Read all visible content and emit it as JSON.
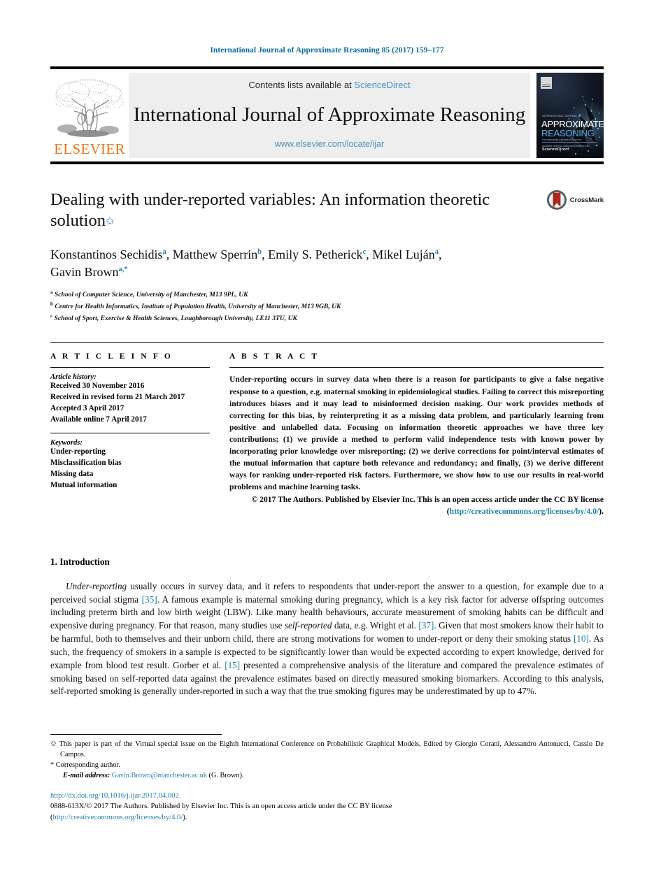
{
  "running_head": "International Journal of Approximate Reasoning 85 (2017) 159–177",
  "masthead": {
    "contents_prefix": "Contents lists available at ",
    "sciencedirect": "ScienceDirect",
    "journal_title": "International Journal of Approximate Reasoning",
    "journal_url": "www.elsevier.com/locate/ijar",
    "publisher_wordmark": "ELSEVIER",
    "cover": {
      "brand_small": "INTERNATIONAL JOURNAL OF",
      "line1": "APPROXIMATE",
      "line2": "REASONING",
      "tagline": "Uncertainty in Intelligent Systems",
      "footer_small": "Available online at www.sciencedirect.com",
      "footer_brand": "ScienceDirect"
    }
  },
  "article": {
    "title": "Dealing with under-reported variables: An information theoretic solution",
    "title_footnote_mark": "✩",
    "crossmark_label": "CrossMark",
    "authors_line1": "Konstantinos Sechidis a, Matthew Sperrin b, Emily S. Petherick c, Mikel Luján a,",
    "authors_line2": "Gavin Brown a,*",
    "authors": [
      {
        "name": "Konstantinos Sechidis",
        "marks": "a"
      },
      {
        "name": "Matthew Sperrin",
        "marks": "b"
      },
      {
        "name": "Emily S. Petherick",
        "marks": "c"
      },
      {
        "name": "Mikel Luján",
        "marks": "a"
      },
      {
        "name": "Gavin Brown",
        "marks": "a,*"
      }
    ],
    "affiliations": [
      {
        "mark": "a",
        "text": "School of Computer Science, University of Manchester, M13 9PL, UK"
      },
      {
        "mark": "b",
        "text": "Centre for Health Informatics, Institute of Population Health, University of Manchester, M13 9GB, UK"
      },
      {
        "mark": "c",
        "text": "School of Sport, Exercise & Health Sciences, Loughborough University, LE11 3TU, UK"
      }
    ]
  },
  "article_info": {
    "heading": "A R T I C L E   I N F O",
    "history_label": "Article history:",
    "history": [
      "Received 30 November 2016",
      "Received in revised form 21 March 2017",
      "Accepted 3 April 2017",
      "Available online 7 April 2017"
    ],
    "keywords_label": "Keywords:",
    "keywords": [
      "Under-reporting",
      "Misclassification bias",
      "Missing data",
      "Mutual information"
    ]
  },
  "abstract": {
    "heading": "A B S T R A C T",
    "body": "Under-reporting occurs in survey data when there is a reason for participants to give a false negative response to a question, e.g. maternal smoking in epidemiological studies. Failing to correct this misreporting introduces biases and it may lead to misinformed decision making. Our work provides methods of correcting for this bias, by reinterpreting it as a missing data problem, and particularly learning from positive and unlabelled data. Focusing on information theoretic approaches we have three key contributions; (1) we provide a method to perform valid independence tests with known power by incorporating prior knowledge over misreporting; (2) we derive corrections for point/interval estimates of the mutual information that capture both relevance and redundancy; and finally, (3) we derive different ways for ranking under-reported risk factors. Furthermore, we show how to use our results in real-world problems and machine learning tasks.",
    "copyright_text": "© 2017 The Authors. Published by Elsevier Inc. This is an open access article under the CC BY license (",
    "copyright_link": "http://creativecommons.org/licenses/by/4.0/",
    "copyright_tail": ")."
  },
  "introduction": {
    "number_title": "1. Introduction",
    "paragraph_parts": [
      {
        "type": "italic",
        "text": "Under-reporting"
      },
      {
        "type": "plain",
        "text": " usually occurs in survey data, and it refers to respondents that under-report the answer to a question, for example due to a perceived social stigma "
      },
      {
        "type": "ref",
        "text": "[35]"
      },
      {
        "type": "plain",
        "text": ". A famous example is maternal smoking during pregnancy, which is a key risk factor for adverse offspring outcomes including preterm birth and low birth weight (LBW). Like many health behaviours, accurate measurement of smoking habits can be difficult and expensive during pregnancy. For that reason, many studies use "
      },
      {
        "type": "italic",
        "text": "self-reported"
      },
      {
        "type": "plain",
        "text": " data, e.g. Wright et al. "
      },
      {
        "type": "ref",
        "text": "[37]"
      },
      {
        "type": "plain",
        "text": ". Given that most smokers know their habit to be harmful, both to themselves and their unborn child, there are strong motivations for women to under-report or deny their smoking status "
      },
      {
        "type": "ref",
        "text": "[10]"
      },
      {
        "type": "plain",
        "text": ". As such, the frequency of smokers in a sample is expected to be significantly lower than would be expected according to expert knowledge, derived for example from blood test result. Gorber et al. "
      },
      {
        "type": "ref",
        "text": "[15]"
      },
      {
        "type": "plain",
        "text": " presented a comprehensive analysis of the literature and compared the prevalence estimates of smoking based on self-reported data against the prevalence estimates based on directly measured smoking biomarkers. According to this analysis, self-reported smoking is generally under-reported in such a way that the true smoking figures may be underestimated by up to 47%."
      }
    ]
  },
  "footnotes": {
    "special_issue_mark": "✩",
    "special_issue": "This paper is part of the Virtual special issue on the Eighth International Conference on Probabilistic Graphical Models, Edited by Giorgio Corani, Alessandro Antonucci, Cassio De Campos.",
    "corresponding_mark": "*",
    "corresponding": "Corresponding author.",
    "email_label": "E-mail address:",
    "email": "Gavin.Brown@manchester.ac.uk",
    "email_owner": "(G. Brown)."
  },
  "footer": {
    "doi": "http://dx.doi.org/10.1016/j.ijar.2017.04.002",
    "issn_line": "0888-613X/© 2017 The Authors. Published by Elsevier Inc. This is an open access article under the CC BY license",
    "license_open": "(",
    "license_link": "http://creativecommons.org/licenses/by/4.0/",
    "license_close": ")."
  },
  "colors": {
    "link_teal": "#1f7fa8",
    "running_head": "#0d6e9e",
    "sciencedirect_blue": "#4a90c2",
    "elsevier_orange": "#e87722",
    "crossmark_red": "#b0281a"
  }
}
